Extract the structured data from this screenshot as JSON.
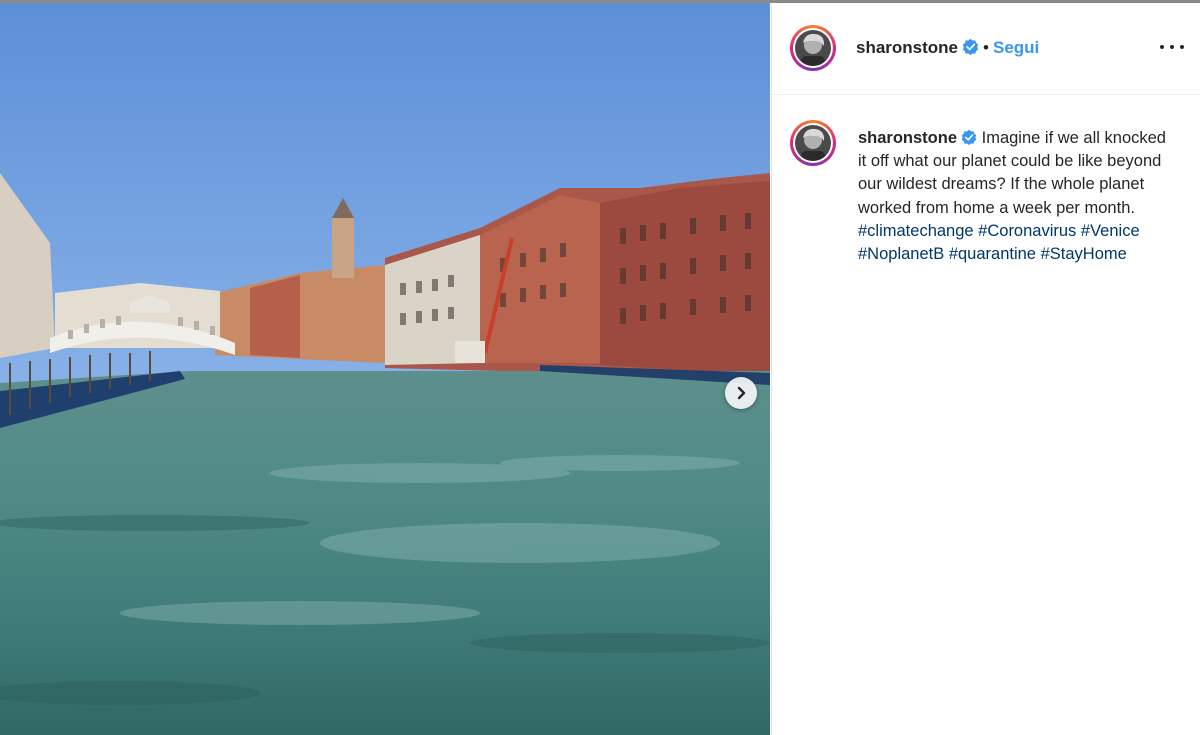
{
  "post": {
    "username": "sharonstone",
    "follow_label": "Segui",
    "separator": "•",
    "verified": true,
    "caption_text": "Imagine if we all knocked it off what our planet could be like beyond our wildest dreams? If the whole planet worked from home a week per month.",
    "hashtags": [
      "#climatechange",
      "#Coronavirus",
      "#Venice",
      "#NoplanetB",
      "#quarantine",
      "#StayHome"
    ]
  },
  "icons": {
    "verified": "verified-badge-icon",
    "more": "more-options-icon",
    "next": "chevron-right-icon"
  },
  "colors": {
    "follow": "#3897f0",
    "verified": "#3897f0",
    "hashtag": "#00376b",
    "text": "#262626"
  }
}
